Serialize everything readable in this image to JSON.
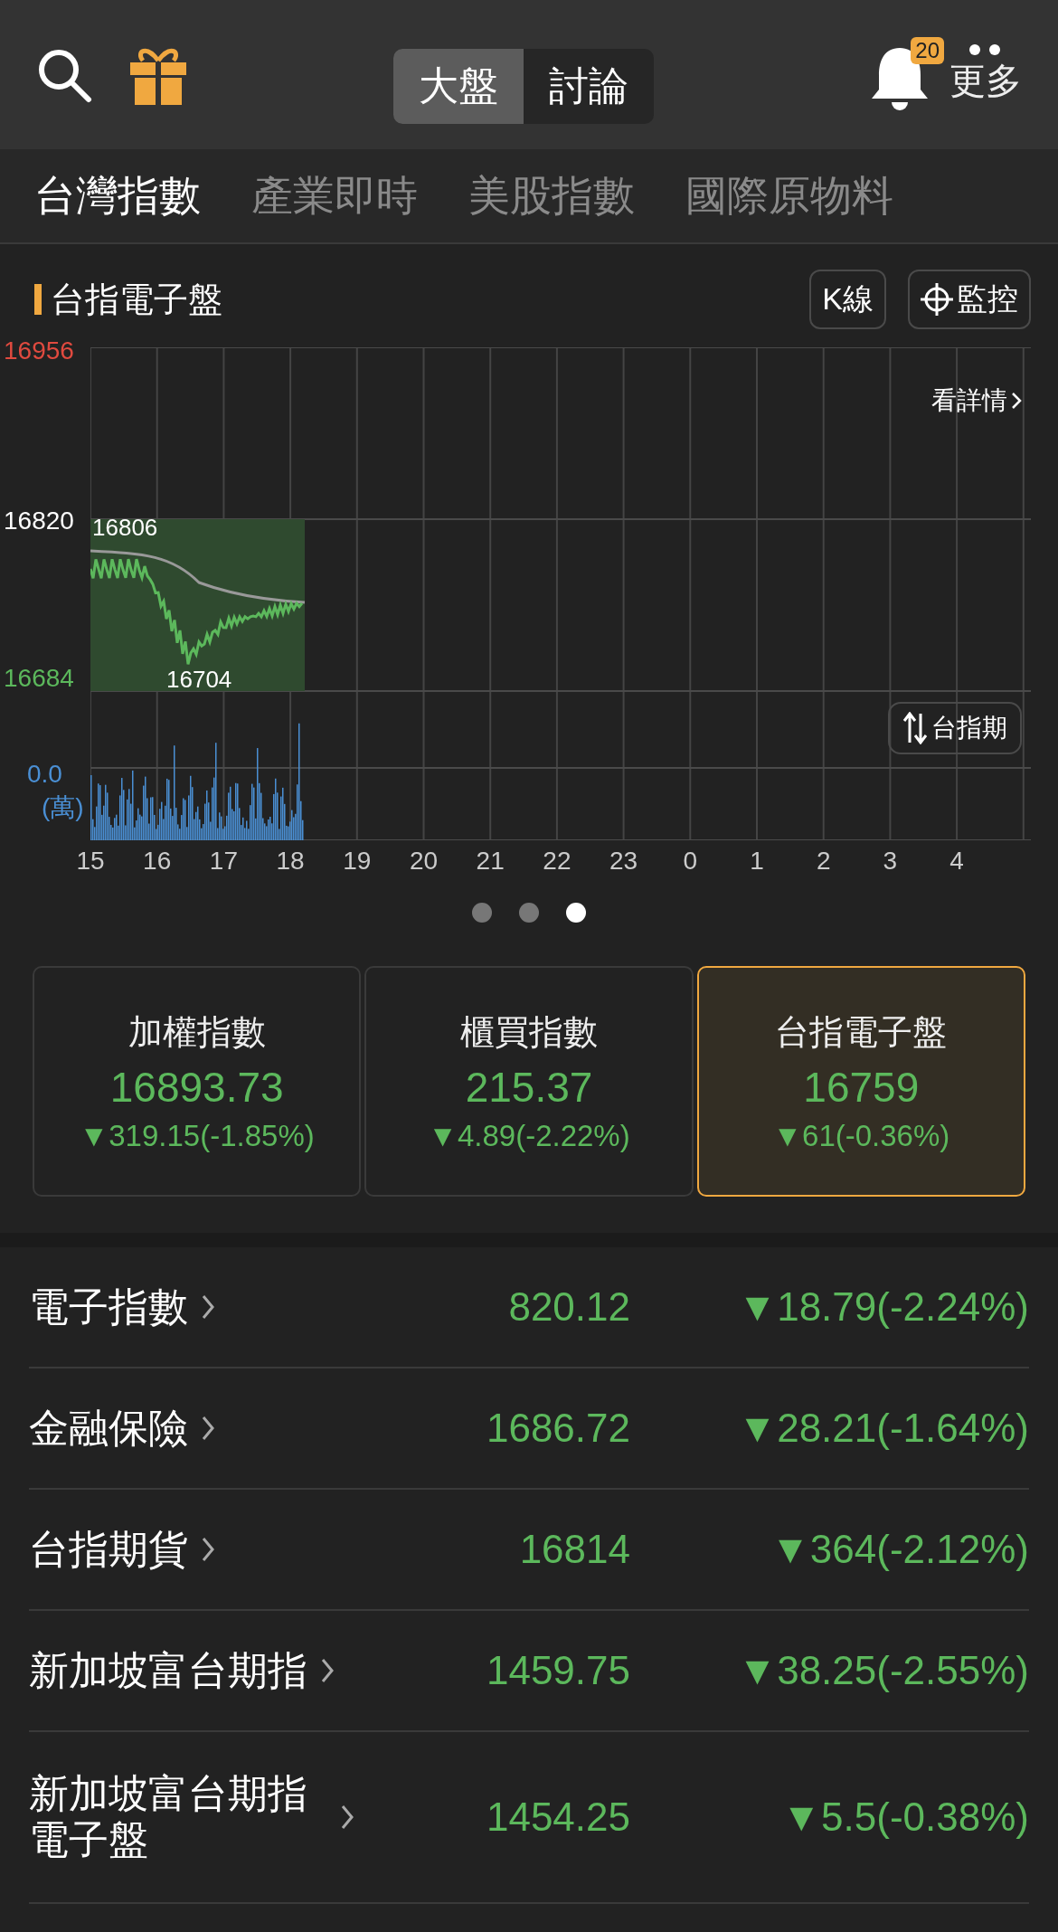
{
  "header": {
    "segments": [
      {
        "label": "大盤",
        "selected": true
      },
      {
        "label": "討論",
        "selected": false
      }
    ],
    "notification_count": "20",
    "more_label": "更多"
  },
  "market_tabs": [
    {
      "label": "台灣指數",
      "selected": true
    },
    {
      "label": "產業即時",
      "selected": false
    },
    {
      "label": "美股指數",
      "selected": false
    },
    {
      "label": "國際原物料",
      "selected": false
    }
  ],
  "chart_panel": {
    "title": "台指電子盤",
    "buttons": [
      {
        "kind": "text",
        "label": "K線"
      },
      {
        "kind": "target",
        "label": "監控"
      }
    ],
    "detail_link": "看詳情",
    "price_labels": {
      "high": "16956",
      "mid": "16820",
      "low": "16684"
    },
    "open_label": "16806",
    "low_label": "16704",
    "volume_value": "0.0",
    "volume_unit": "(萬)",
    "switch_button": "台指期",
    "time_labels": [
      "15",
      "16",
      "17",
      "18",
      "19",
      "20",
      "21",
      "22",
      "23",
      "0",
      "1",
      "2",
      "3",
      "4"
    ]
  },
  "pager": [
    {
      "selected": false
    },
    {
      "selected": false
    },
    {
      "selected": true
    }
  ],
  "index_cards": [
    {
      "title": "加權指數",
      "value": "16893.73",
      "change": "▼319.15(-1.85%)",
      "selected": false
    },
    {
      "title": "櫃買指數",
      "value": "215.37",
      "change": "▼4.89(-2.22%)",
      "selected": false
    },
    {
      "title": "台指電子盤",
      "value": "16759",
      "change": "▼61(-0.36%)",
      "selected": true
    }
  ],
  "sectors": [
    {
      "name": "電子指數",
      "value": "820.12",
      "change": "▼18.79(-2.24%)"
    },
    {
      "name": "金融保險",
      "value": "1686.72",
      "change": "▼28.21(-1.64%)"
    },
    {
      "name": "台指期貨",
      "value": "16814",
      "change": "▼364(-2.12%)"
    },
    {
      "name": "新加坡富台期指",
      "value": "1459.75",
      "change": "▼38.25(-2.55%)"
    },
    {
      "name": "新加坡富台期指電子盤",
      "value": "1454.25",
      "change": "▼5.5(-0.38%)"
    }
  ]
}
